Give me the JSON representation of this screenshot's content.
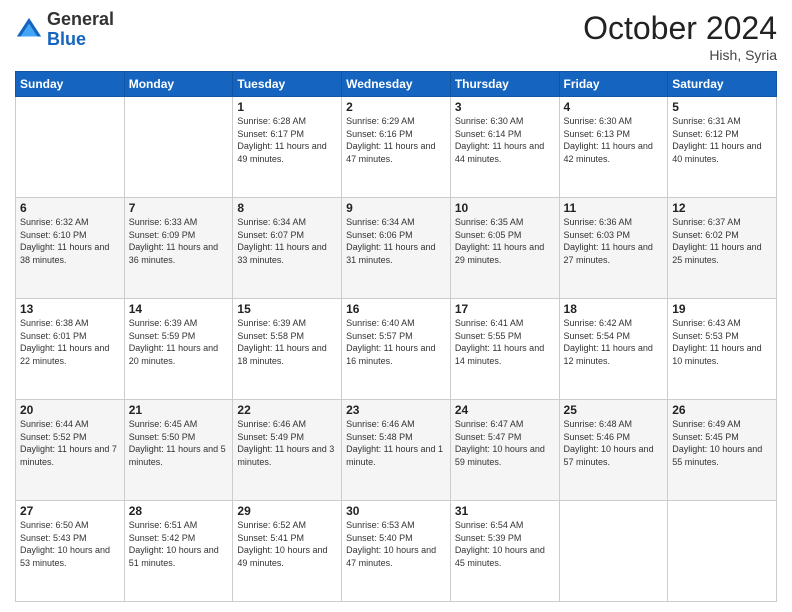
{
  "logo": {
    "general": "General",
    "blue": "Blue"
  },
  "header": {
    "month": "October 2024",
    "location": "Hish, Syria"
  },
  "weekdays": [
    "Sunday",
    "Monday",
    "Tuesday",
    "Wednesday",
    "Thursday",
    "Friday",
    "Saturday"
  ],
  "weeks": [
    [
      {
        "day": "",
        "sunrise": "",
        "sunset": "",
        "daylight": ""
      },
      {
        "day": "",
        "sunrise": "",
        "sunset": "",
        "daylight": ""
      },
      {
        "day": "1",
        "sunrise": "Sunrise: 6:28 AM",
        "sunset": "Sunset: 6:17 PM",
        "daylight": "Daylight: 11 hours and 49 minutes."
      },
      {
        "day": "2",
        "sunrise": "Sunrise: 6:29 AM",
        "sunset": "Sunset: 6:16 PM",
        "daylight": "Daylight: 11 hours and 47 minutes."
      },
      {
        "day": "3",
        "sunrise": "Sunrise: 6:30 AM",
        "sunset": "Sunset: 6:14 PM",
        "daylight": "Daylight: 11 hours and 44 minutes."
      },
      {
        "day": "4",
        "sunrise": "Sunrise: 6:30 AM",
        "sunset": "Sunset: 6:13 PM",
        "daylight": "Daylight: 11 hours and 42 minutes."
      },
      {
        "day": "5",
        "sunrise": "Sunrise: 6:31 AM",
        "sunset": "Sunset: 6:12 PM",
        "daylight": "Daylight: 11 hours and 40 minutes."
      }
    ],
    [
      {
        "day": "6",
        "sunrise": "Sunrise: 6:32 AM",
        "sunset": "Sunset: 6:10 PM",
        "daylight": "Daylight: 11 hours and 38 minutes."
      },
      {
        "day": "7",
        "sunrise": "Sunrise: 6:33 AM",
        "sunset": "Sunset: 6:09 PM",
        "daylight": "Daylight: 11 hours and 36 minutes."
      },
      {
        "day": "8",
        "sunrise": "Sunrise: 6:34 AM",
        "sunset": "Sunset: 6:07 PM",
        "daylight": "Daylight: 11 hours and 33 minutes."
      },
      {
        "day": "9",
        "sunrise": "Sunrise: 6:34 AM",
        "sunset": "Sunset: 6:06 PM",
        "daylight": "Daylight: 11 hours and 31 minutes."
      },
      {
        "day": "10",
        "sunrise": "Sunrise: 6:35 AM",
        "sunset": "Sunset: 6:05 PM",
        "daylight": "Daylight: 11 hours and 29 minutes."
      },
      {
        "day": "11",
        "sunrise": "Sunrise: 6:36 AM",
        "sunset": "Sunset: 6:03 PM",
        "daylight": "Daylight: 11 hours and 27 minutes."
      },
      {
        "day": "12",
        "sunrise": "Sunrise: 6:37 AM",
        "sunset": "Sunset: 6:02 PM",
        "daylight": "Daylight: 11 hours and 25 minutes."
      }
    ],
    [
      {
        "day": "13",
        "sunrise": "Sunrise: 6:38 AM",
        "sunset": "Sunset: 6:01 PM",
        "daylight": "Daylight: 11 hours and 22 minutes."
      },
      {
        "day": "14",
        "sunrise": "Sunrise: 6:39 AM",
        "sunset": "Sunset: 5:59 PM",
        "daylight": "Daylight: 11 hours and 20 minutes."
      },
      {
        "day": "15",
        "sunrise": "Sunrise: 6:39 AM",
        "sunset": "Sunset: 5:58 PM",
        "daylight": "Daylight: 11 hours and 18 minutes."
      },
      {
        "day": "16",
        "sunrise": "Sunrise: 6:40 AM",
        "sunset": "Sunset: 5:57 PM",
        "daylight": "Daylight: 11 hours and 16 minutes."
      },
      {
        "day": "17",
        "sunrise": "Sunrise: 6:41 AM",
        "sunset": "Sunset: 5:55 PM",
        "daylight": "Daylight: 11 hours and 14 minutes."
      },
      {
        "day": "18",
        "sunrise": "Sunrise: 6:42 AM",
        "sunset": "Sunset: 5:54 PM",
        "daylight": "Daylight: 11 hours and 12 minutes."
      },
      {
        "day": "19",
        "sunrise": "Sunrise: 6:43 AM",
        "sunset": "Sunset: 5:53 PM",
        "daylight": "Daylight: 11 hours and 10 minutes."
      }
    ],
    [
      {
        "day": "20",
        "sunrise": "Sunrise: 6:44 AM",
        "sunset": "Sunset: 5:52 PM",
        "daylight": "Daylight: 11 hours and 7 minutes."
      },
      {
        "day": "21",
        "sunrise": "Sunrise: 6:45 AM",
        "sunset": "Sunset: 5:50 PM",
        "daylight": "Daylight: 11 hours and 5 minutes."
      },
      {
        "day": "22",
        "sunrise": "Sunrise: 6:46 AM",
        "sunset": "Sunset: 5:49 PM",
        "daylight": "Daylight: 11 hours and 3 minutes."
      },
      {
        "day": "23",
        "sunrise": "Sunrise: 6:46 AM",
        "sunset": "Sunset: 5:48 PM",
        "daylight": "Daylight: 11 hours and 1 minute."
      },
      {
        "day": "24",
        "sunrise": "Sunrise: 6:47 AM",
        "sunset": "Sunset: 5:47 PM",
        "daylight": "Daylight: 10 hours and 59 minutes."
      },
      {
        "day": "25",
        "sunrise": "Sunrise: 6:48 AM",
        "sunset": "Sunset: 5:46 PM",
        "daylight": "Daylight: 10 hours and 57 minutes."
      },
      {
        "day": "26",
        "sunrise": "Sunrise: 6:49 AM",
        "sunset": "Sunset: 5:45 PM",
        "daylight": "Daylight: 10 hours and 55 minutes."
      }
    ],
    [
      {
        "day": "27",
        "sunrise": "Sunrise: 6:50 AM",
        "sunset": "Sunset: 5:43 PM",
        "daylight": "Daylight: 10 hours and 53 minutes."
      },
      {
        "day": "28",
        "sunrise": "Sunrise: 6:51 AM",
        "sunset": "Sunset: 5:42 PM",
        "daylight": "Daylight: 10 hours and 51 minutes."
      },
      {
        "day": "29",
        "sunrise": "Sunrise: 6:52 AM",
        "sunset": "Sunset: 5:41 PM",
        "daylight": "Daylight: 10 hours and 49 minutes."
      },
      {
        "day": "30",
        "sunrise": "Sunrise: 6:53 AM",
        "sunset": "Sunset: 5:40 PM",
        "daylight": "Daylight: 10 hours and 47 minutes."
      },
      {
        "day": "31",
        "sunrise": "Sunrise: 6:54 AM",
        "sunset": "Sunset: 5:39 PM",
        "daylight": "Daylight: 10 hours and 45 minutes."
      },
      {
        "day": "",
        "sunrise": "",
        "sunset": "",
        "daylight": ""
      },
      {
        "day": "",
        "sunrise": "",
        "sunset": "",
        "daylight": ""
      }
    ]
  ]
}
